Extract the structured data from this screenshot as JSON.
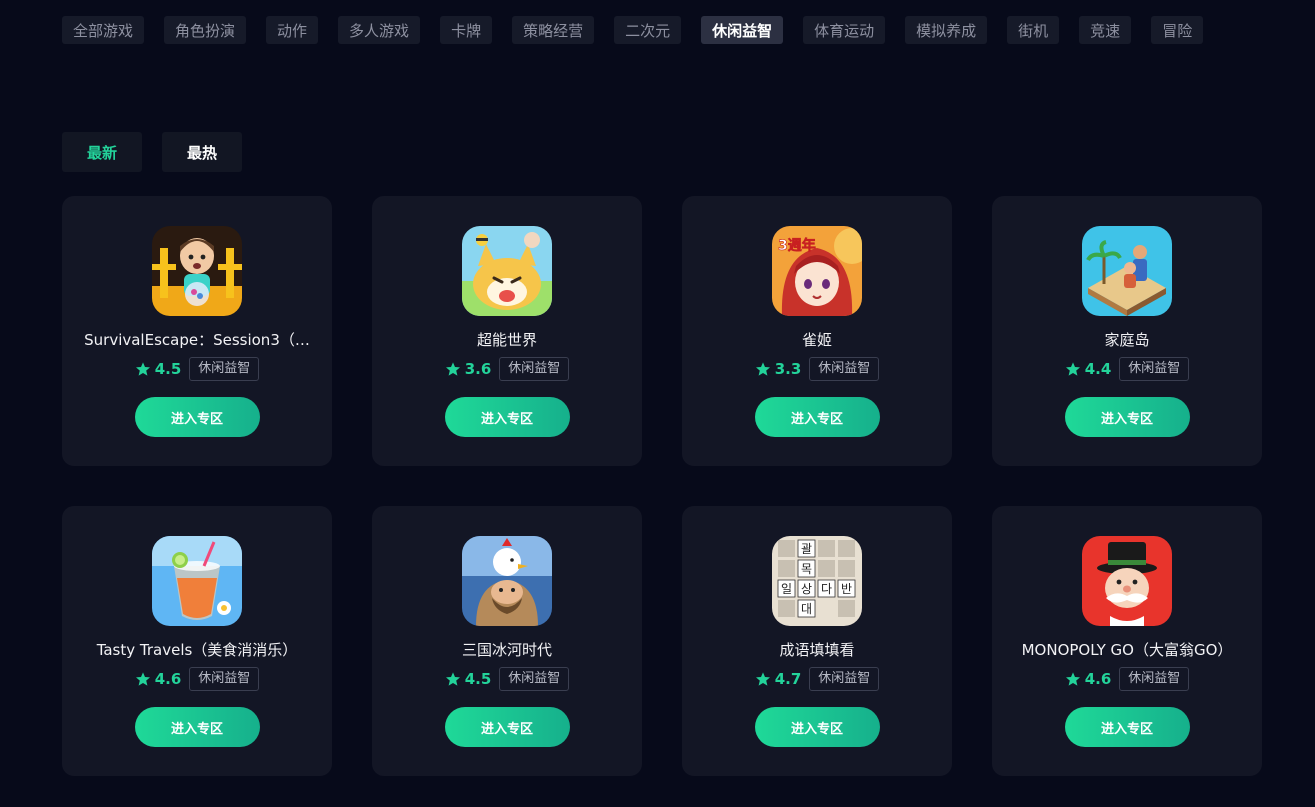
{
  "categories": [
    {
      "label": "全部游戏",
      "active": false
    },
    {
      "label": "角色扮演",
      "active": false
    },
    {
      "label": "动作",
      "active": false
    },
    {
      "label": "多人游戏",
      "active": false
    },
    {
      "label": "卡牌",
      "active": false
    },
    {
      "label": "策略经营",
      "active": false
    },
    {
      "label": "二次元",
      "active": false
    },
    {
      "label": "休闲益智",
      "active": true
    },
    {
      "label": "体育运动",
      "active": false
    },
    {
      "label": "模拟养成",
      "active": false
    },
    {
      "label": "街机",
      "active": false
    },
    {
      "label": "竞速",
      "active": false
    },
    {
      "label": "冒险",
      "active": false
    }
  ],
  "sort_tabs": [
    {
      "label": "最新",
      "active": true
    },
    {
      "label": "最热",
      "active": false
    }
  ],
  "games": [
    {
      "name": "SurvivalEscape：Session3（…",
      "rating": "4.5",
      "tag": "休闲益智",
      "button": "进入专区",
      "icon": "survival-escape-game-icon",
      "icon_colors": [
        "#f0a818",
        "#2a1a10"
      ]
    },
    {
      "name": "超能世界",
      "rating": "3.6",
      "tag": "休闲益智",
      "button": "进入专区",
      "icon": "super-world-game-icon",
      "icon_colors": [
        "#9ee06a",
        "#f6c54a"
      ]
    },
    {
      "name": "雀姬",
      "rating": "3.3",
      "tag": "休闲益智",
      "button": "进入专区",
      "icon": "mahjong-girl-game-icon",
      "icon_colors": [
        "#f3a23a",
        "#c8322a"
      ]
    },
    {
      "name": "家庭岛",
      "rating": "4.4",
      "tag": "休闲益智",
      "button": "进入专区",
      "icon": "family-island-game-icon",
      "icon_colors": [
        "#3fc3e8",
        "#c98a4a"
      ]
    },
    {
      "name": "Tasty Travels（美食消消乐）",
      "rating": "4.6",
      "tag": "休闲益智",
      "button": "进入专区",
      "icon": "tasty-travels-game-icon",
      "icon_colors": [
        "#5fb6f4",
        "#f07f3a"
      ]
    },
    {
      "name": "三国冰河时代",
      "rating": "4.5",
      "tag": "休闲益智",
      "button": "进入专区",
      "icon": "three-kingdoms-ice-age-game-icon",
      "icon_colors": [
        "#3d6fb0",
        "#b58a5a"
      ]
    },
    {
      "name": "成语填填看",
      "rating": "4.7",
      "tag": "休闲益智",
      "button": "进入专区",
      "icon": "idiom-crossword-game-icon",
      "icon_colors": [
        "#e8e0d2",
        "#222222"
      ]
    },
    {
      "name": "MONOPOLY GO（大富翁GO）",
      "rating": "4.6",
      "tag": "休闲益智",
      "button": "进入专区",
      "icon": "monopoly-go-game-icon",
      "icon_colors": [
        "#e8342c",
        "#1a1a1a"
      ]
    }
  ],
  "icon_tiles": {
    "crossword": [
      "괄",
      "목",
      "일",
      "상",
      "다",
      "반",
      "대"
    ],
    "anniversary_badge": "3週年"
  },
  "colors": {
    "accent": "#23d39a",
    "background": "#070a1a",
    "card": "#131625",
    "chip_active": "#2c3042"
  }
}
